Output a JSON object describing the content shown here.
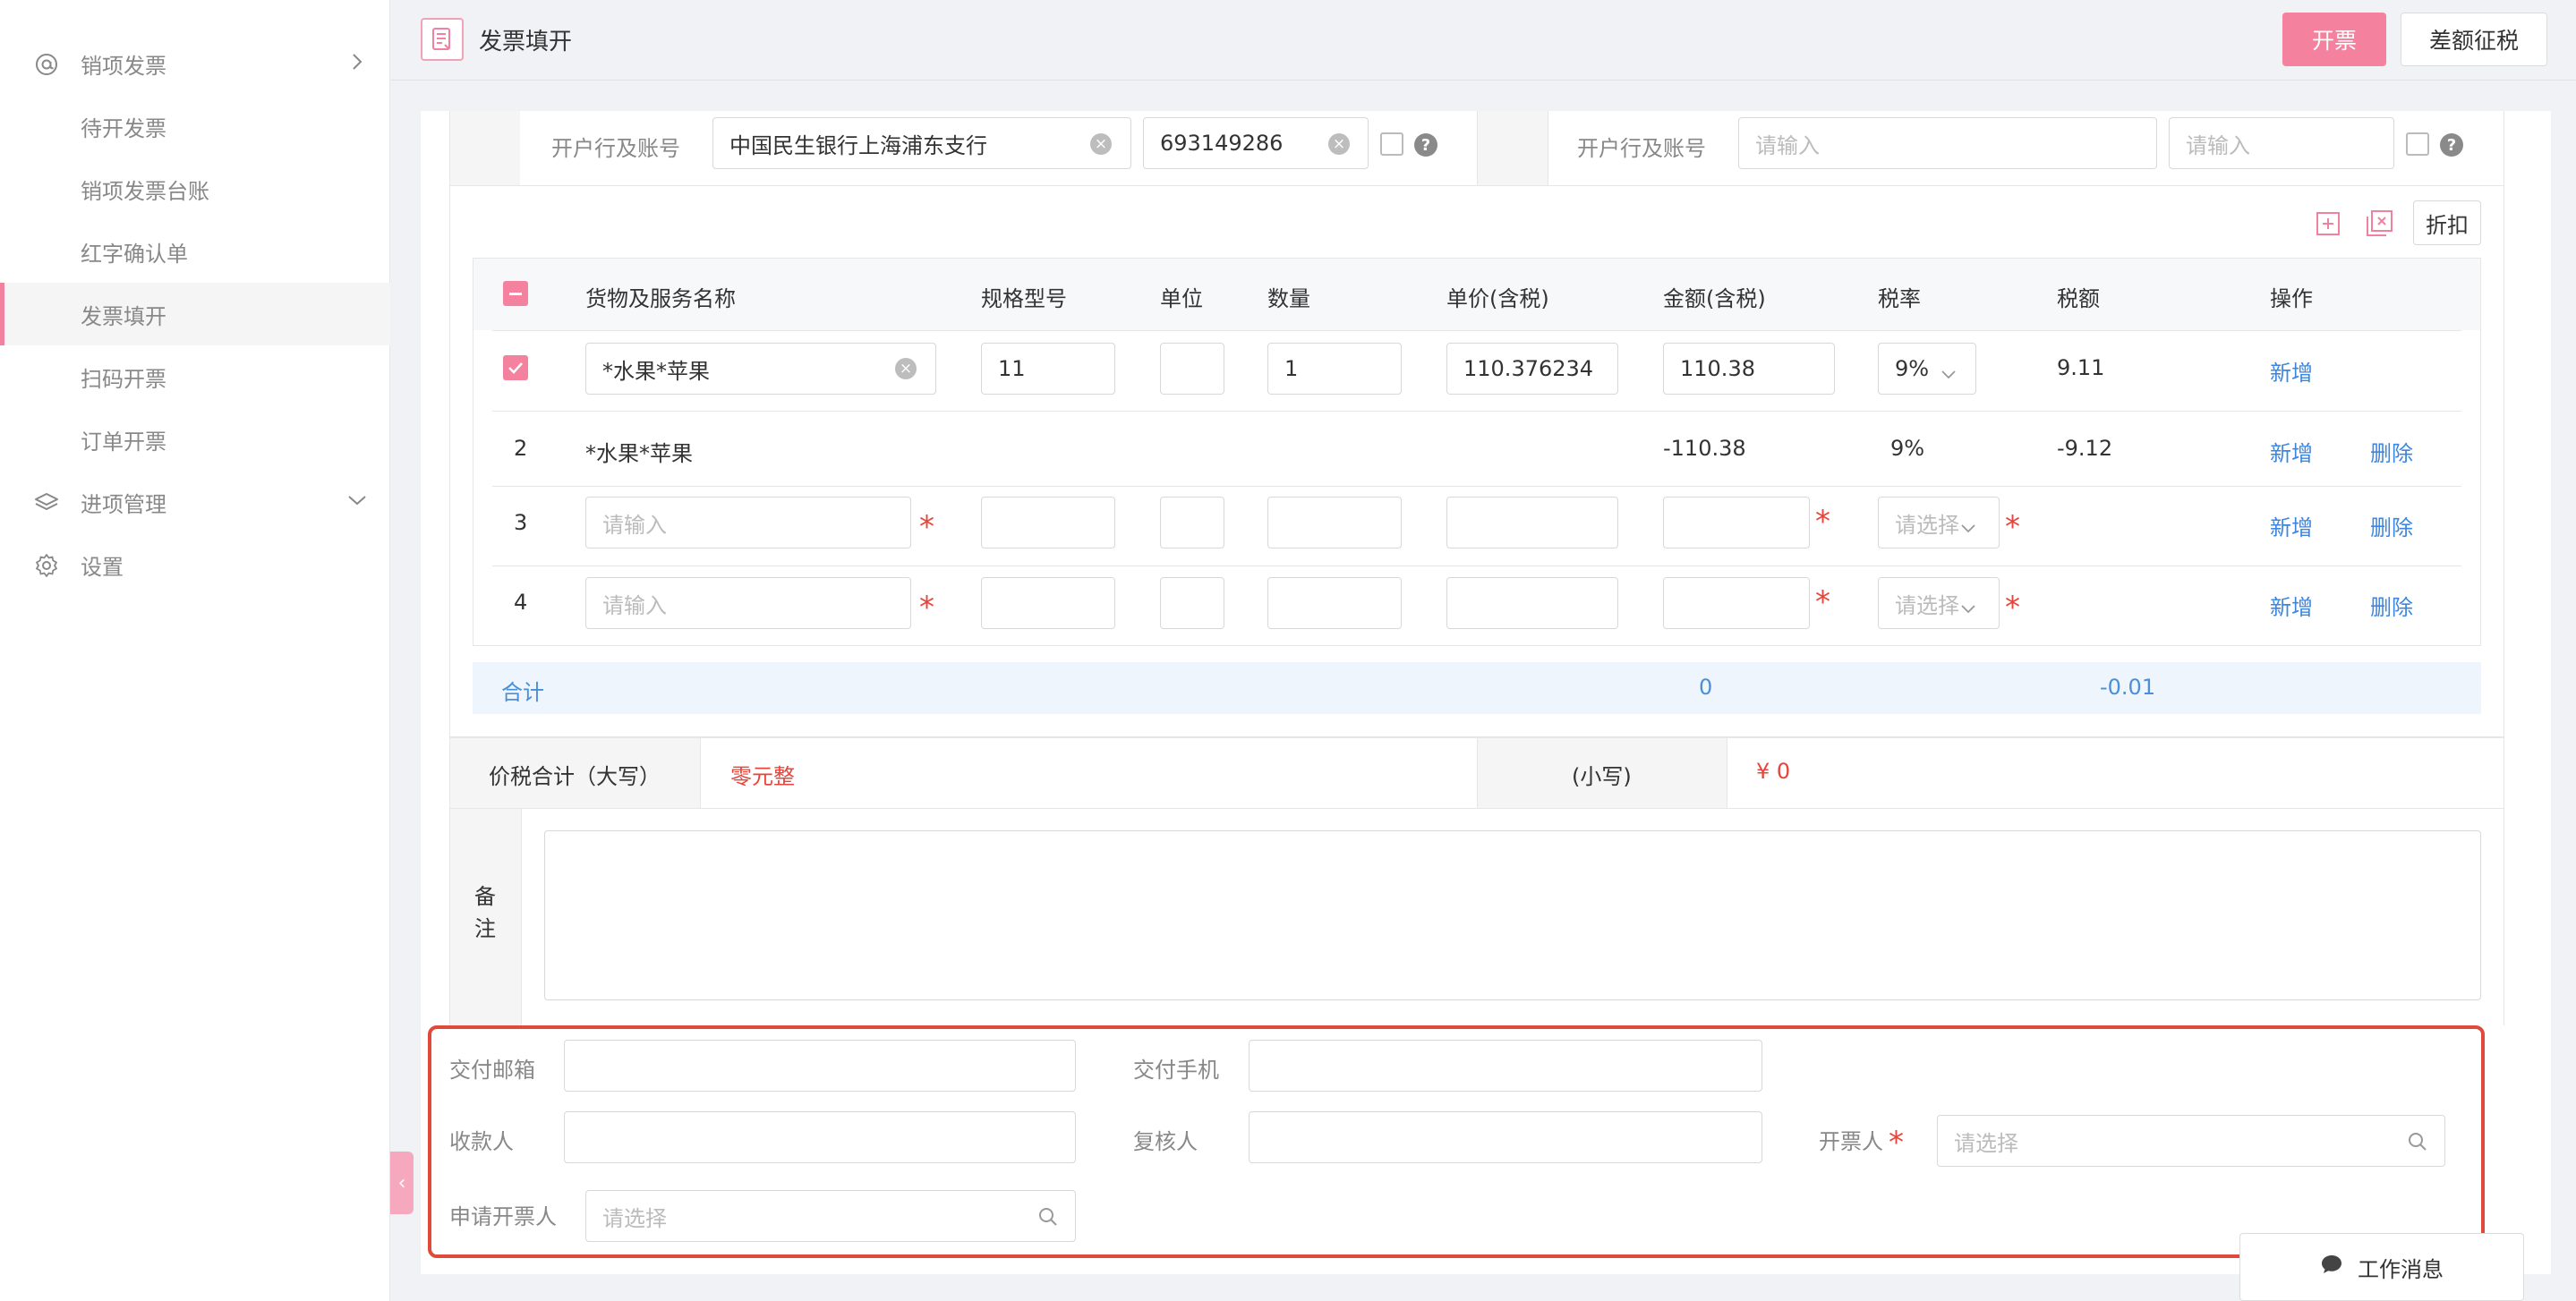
{
  "sidebar": {
    "items": [
      {
        "label": "销项发票",
        "icon": "at-icon"
      },
      {
        "label": "待开发票"
      },
      {
        "label": "销项发票台账"
      },
      {
        "label": "红字确认单"
      },
      {
        "label": "发票填开",
        "active": true
      },
      {
        "label": "扫码开票"
      },
      {
        "label": "订单开票"
      },
      {
        "label": "进项管理",
        "icon": "layers-icon"
      },
      {
        "label": "设置",
        "icon": "gear-icon"
      }
    ]
  },
  "header": {
    "title": "发票填开",
    "issue_button": "开票",
    "diff_tax_button": "差额征税"
  },
  "bank": {
    "label": "开户行及账号",
    "bank_value": "中国民生银行上海浦东支行",
    "account_value": "693149286",
    "buyer_label": "开户行及账号",
    "buyer_bank_placeholder": "请输入",
    "buyer_account_placeholder": "请输入"
  },
  "toolbar": {
    "discount_label": "折扣"
  },
  "table": {
    "headers": [
      "货物及服务名称",
      "规格型号",
      "单位",
      "数量",
      "单价(含税)",
      "金额(含税)",
      "税率",
      "税额",
      "操作"
    ],
    "rows": [
      {
        "name": "*水果*苹果",
        "spec": "11",
        "unit": "",
        "qty": "1",
        "price": "110.376234",
        "amount": "110.38",
        "rate": "9%",
        "tax": "9.11",
        "add": "新增"
      },
      {
        "index": "2",
        "name": "*水果*苹果",
        "amount": "-110.38",
        "rate": "9%",
        "tax": "-9.12",
        "add": "新增",
        "del": "删除"
      },
      {
        "index": "3",
        "name_placeholder": "请输入",
        "rate_placeholder": "请选择",
        "add": "新增",
        "del": "删除"
      },
      {
        "index": "4",
        "name_placeholder": "请输入",
        "rate_placeholder": "请选择",
        "add": "新增",
        "del": "删除"
      }
    ],
    "total": {
      "label": "合计",
      "amount": "0",
      "tax": "-0.01"
    }
  },
  "sum": {
    "upper_label": "价税合计（大写）",
    "upper_value": "零元整",
    "lower_label": "(小写)",
    "lower_value": "¥ 0"
  },
  "remarks": {
    "label_1": "备",
    "label_2": "注"
  },
  "delivery": {
    "email_label": "交付邮箱",
    "phone_label": "交付手机",
    "payee_label": "收款人",
    "reviewer_label": "复核人",
    "drawer_label": "开票人",
    "drawer_placeholder": "请选择",
    "applicant_label": "申请开票人",
    "applicant_placeholder": "请选择"
  },
  "work_message": "工作消息",
  "colors": {
    "accent": "#f4829f",
    "link": "#3c86e0",
    "required": "#e9443a",
    "highlight": "#e04a39"
  }
}
